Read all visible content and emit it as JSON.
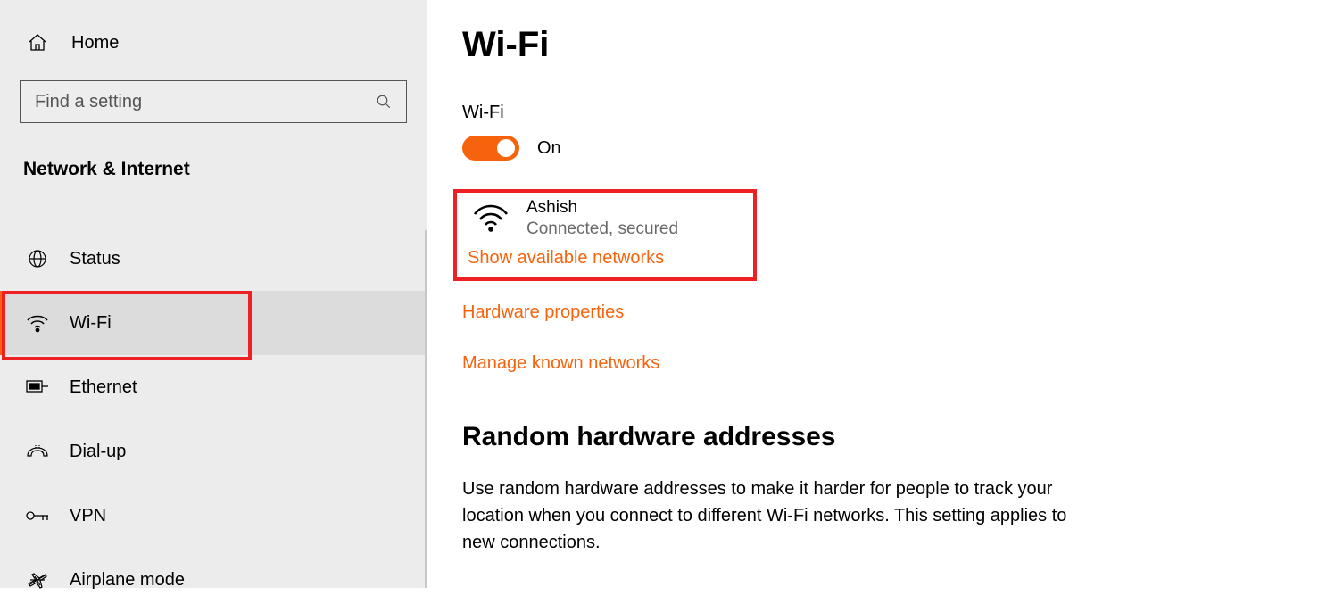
{
  "sidebar": {
    "home": "Home",
    "search_placeholder": "Find a setting",
    "category": "Network & Internet",
    "items": [
      {
        "label": "Status"
      },
      {
        "label": "Wi-Fi"
      },
      {
        "label": "Ethernet"
      },
      {
        "label": "Dial-up"
      },
      {
        "label": "VPN"
      },
      {
        "label": "Airplane mode"
      }
    ]
  },
  "main": {
    "title": "Wi-Fi",
    "wifi_label": "Wi-Fi",
    "toggle_state": "On",
    "network": {
      "name": "Ashish",
      "status": "Connected, secured"
    },
    "links": {
      "show_available": "Show available networks",
      "hardware_props": "Hardware properties",
      "manage_known": "Manage known networks"
    },
    "random": {
      "title": "Random hardware addresses",
      "body": "Use random hardware addresses to make it harder for people to track your location when you connect to different Wi-Fi networks. This setting applies to new connections."
    }
  }
}
